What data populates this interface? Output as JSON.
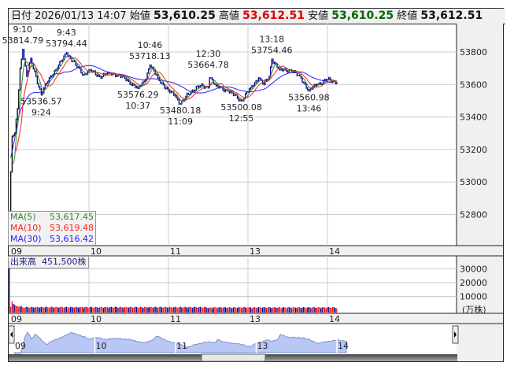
{
  "header": {
    "date_label": "日付",
    "datetime": "2026/01/13 14:07",
    "open_label": "始値",
    "open": "53,610.25",
    "high_label": "高値",
    "high": "53,612.51",
    "low_label": "安値",
    "low": "53,610.25",
    "close_label": "終値",
    "close": "53,612.51"
  },
  "legend": {
    "ma5_label": "MA(5)",
    "ma5_value": "53,617.45",
    "ma10_label": "MA(10)",
    "ma10_value": "53,619.48",
    "ma30_label": "MA(30)",
    "ma30_value": "53,616.42"
  },
  "volume_legend": {
    "label": "出来高",
    "value": "451,500株"
  },
  "volume_unit": "(万株)",
  "colors": {
    "ma5": "#2e8b2e",
    "ma10": "#ff2020",
    "ma30": "#2020ff",
    "price": "#000080",
    "up": "#ff0000",
    "down": "#000090",
    "nav_fill": "#b9c7f5"
  },
  "chart_data": {
    "type": "line",
    "title": "Intraday 1-minute chart",
    "x_ticks": [
      "09",
      "10",
      "11",
      "13",
      "14"
    ],
    "y_ticks": [
      53800,
      53600,
      53400,
      53200,
      53000,
      52800
    ],
    "ylim": [
      52650,
      53920
    ],
    "volume_ticks": [
      30000,
      20000,
      10000
    ],
    "price_keypoints": [
      [
        "9:00",
        52820
      ],
      [
        "9:02",
        53280
      ],
      [
        "9:04",
        53300
      ],
      [
        "9:06",
        53450
      ],
      [
        "9:08",
        53700
      ],
      [
        "9:10",
        53814.79
      ],
      [
        "9:13",
        53650
      ],
      [
        "9:16",
        53760
      ],
      [
        "9:20",
        53650
      ],
      [
        "9:24",
        53536.57
      ],
      [
        "9:30",
        53640
      ],
      [
        "9:36",
        53700
      ],
      [
        "9:43",
        53794.44
      ],
      [
        "9:50",
        53720
      ],
      [
        "9:56",
        53660
      ],
      [
        "10:00",
        53690
      ],
      [
        "10:08",
        53650
      ],
      [
        "10:15",
        53670
      ],
      [
        "10:22",
        53660
      ],
      [
        "10:30",
        53620
      ],
      [
        "10:37",
        53576.29
      ],
      [
        "10:42",
        53620
      ],
      [
        "10:46",
        53718.13
      ],
      [
        "10:52",
        53640
      ],
      [
        "11:00",
        53560
      ],
      [
        "11:05",
        53530
      ],
      [
        "11:09",
        53480.18
      ],
      [
        "11:15",
        53540
      ],
      [
        "11:22",
        53590
      ],
      [
        "11:30",
        53580
      ],
      [
        "12:30",
        53664.78
      ],
      [
        "12:36",
        53590
      ],
      [
        "12:45",
        53560
      ],
      [
        "12:55",
        53500.08
      ],
      [
        "13:02",
        53580
      ],
      [
        "13:08",
        53640
      ],
      [
        "13:12",
        53600
      ],
      [
        "13:16",
        53650
      ],
      [
        "13:18",
        53754.46
      ],
      [
        "13:24",
        53690
      ],
      [
        "13:32",
        53690
      ],
      [
        "13:40",
        53640
      ],
      [
        "13:46",
        53560.98
      ],
      [
        "13:52",
        53600
      ],
      [
        "14:00",
        53630
      ],
      [
        "14:04",
        53620
      ],
      [
        "14:07",
        53612.51
      ]
    ],
    "annotations": [
      {
        "time": "9:10",
        "price": "53814.79",
        "pos": "above"
      },
      {
        "time": "9:43",
        "price": "53794.44",
        "pos": "above"
      },
      {
        "time": "10:46",
        "price": "53718.13",
        "pos": "above"
      },
      {
        "time": "12:30",
        "price": "53664.78",
        "pos": "above"
      },
      {
        "time": "13:18",
        "price": "53754.46",
        "pos": "above"
      },
      {
        "time": "9:24",
        "price": "53536.57",
        "pos": "below"
      },
      {
        "time": "10:37",
        "price": "53576.29",
        "pos": "below"
      },
      {
        "time": "11:09",
        "price": "53480.18",
        "pos": "below"
      },
      {
        "time": "12:55",
        "price": "53500.08",
        "pos": "below"
      },
      {
        "time": "13:46",
        "price": "53560.98",
        "pos": "below"
      }
    ],
    "volume_keypoints": [
      [
        "9:00",
        36000
      ],
      [
        "9:01",
        2500
      ],
      [
        "9:02",
        6500
      ],
      [
        "9:04",
        4000
      ],
      [
        "9:10",
        2200
      ],
      [
        "11:30",
        1600
      ],
      [
        "12:30",
        14000
      ],
      [
        "12:31",
        1800
      ],
      [
        "14:07",
        1400
      ]
    ]
  }
}
